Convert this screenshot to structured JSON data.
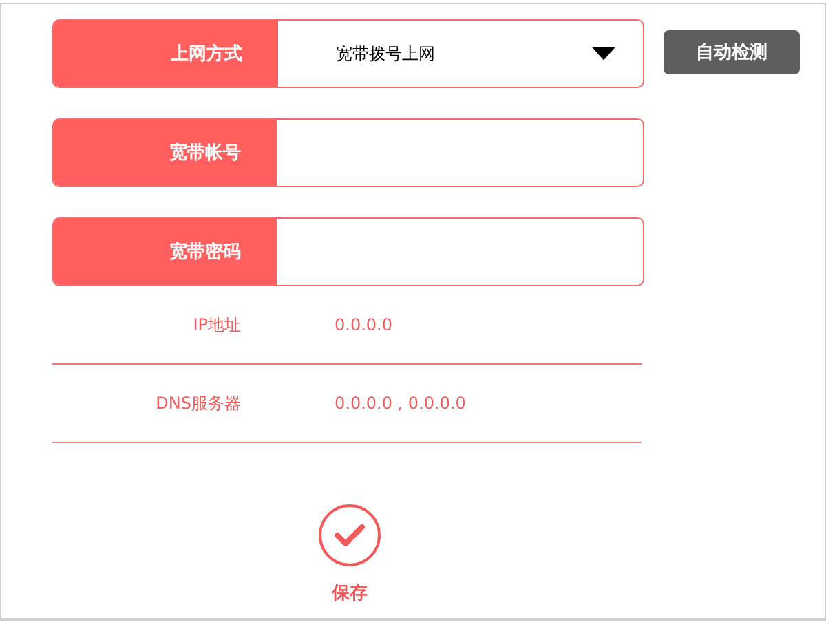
{
  "fields": [
    {
      "kind": "select",
      "label": "上网方式",
      "value": "宽带拨号上网"
    },
    {
      "kind": "text",
      "label": "宽带帐号"
    },
    {
      "kind": "password",
      "label": "宽带密码"
    }
  ],
  "detect_button": "自动检测",
  "info": [
    {
      "label": "IP地址",
      "value": "0.0.0.0"
    },
    {
      "label": "DNS服务器",
      "value": "0.0.0.0 , 0.0.0.0"
    }
  ],
  "save_button": "保存"
}
